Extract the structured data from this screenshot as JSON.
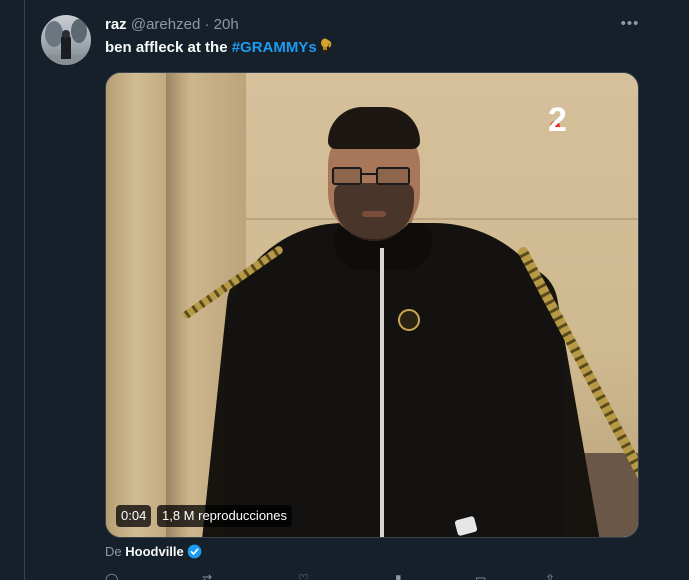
{
  "tweet": {
    "author": {
      "display_name": "raz",
      "handle": "@arehzed",
      "separator": "·",
      "time": "20h"
    },
    "text": {
      "plain": "ben affleck at the ",
      "hashtag": "#GRAMMYs"
    },
    "more_icon": "more-horizontal-icon",
    "media": {
      "type": "video",
      "channel_logo": "2",
      "time": "0:04",
      "views": "1,8 M reproducciones"
    },
    "attribution": {
      "prefix": "De",
      "source": "Hoodville",
      "verified_icon": "verified-badge-icon"
    },
    "actions": [
      "reply-icon",
      "retweet-icon",
      "like-icon",
      "views-icon",
      "bookmark-icon",
      "share-icon"
    ]
  },
  "colors": {
    "background": "#15202b",
    "text": "#f7f9f9",
    "secondary_text": "#8b98a5",
    "accent": "#1d9bf0",
    "border": "#38444d"
  }
}
